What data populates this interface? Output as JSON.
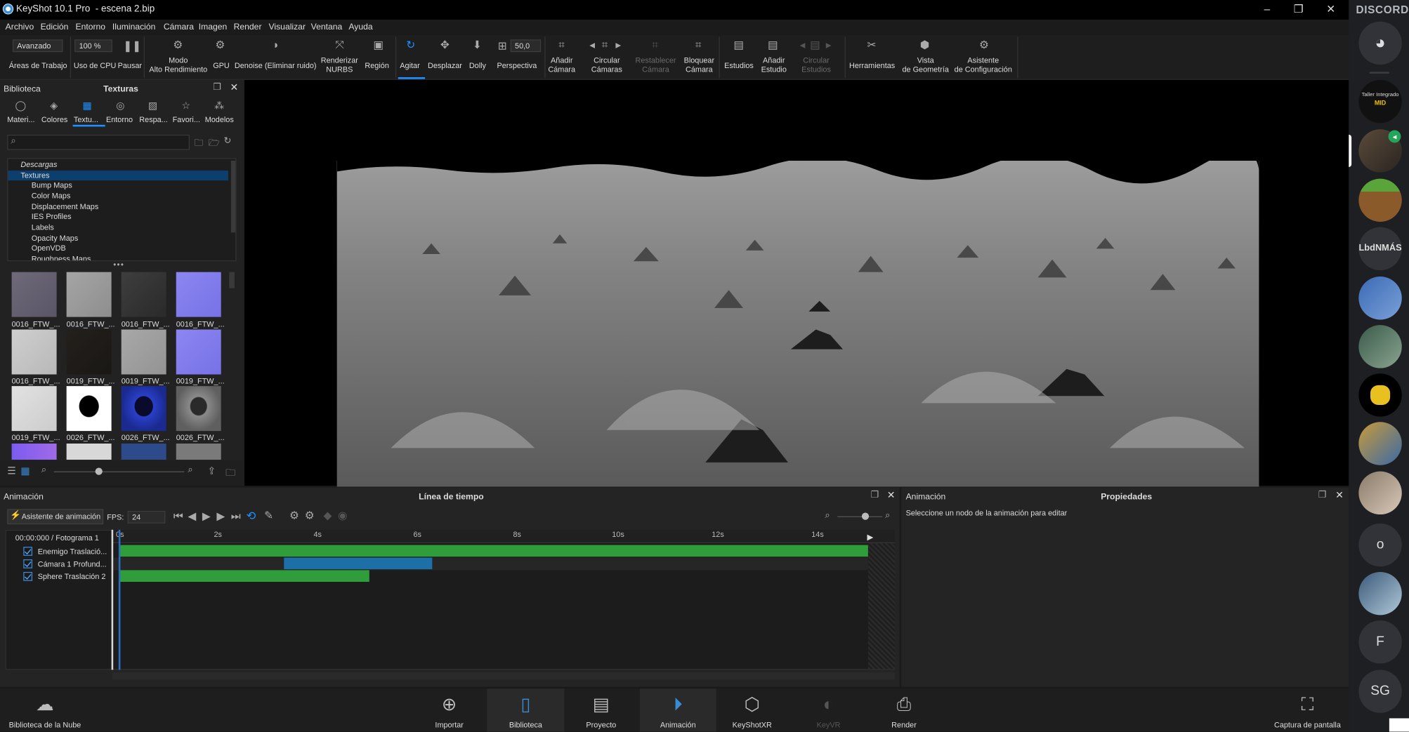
{
  "window": {
    "title": "KeyShot 10.1 Pro  - escena 2.bip"
  },
  "menu": [
    "Archivo",
    "Edición",
    "Entorno",
    "Iluminación",
    "Cámara",
    "Imagen",
    "Render",
    "Visualizar",
    "Ventana",
    "Ayuda"
  ],
  "toolbar": {
    "workspace_dropdown": "Avanzado",
    "cpu_dropdown": "100 %",
    "perspective_value": "50,0",
    "areas": "Áreas de Trabajo",
    "cpu": "Uso de CPU",
    "pause": "Pausar",
    "high_perf_1": "Modo",
    "high_perf_2": "Alto Rendimiento",
    "gpu": "GPU",
    "denoise": "Denoise (Eliminar ruido)",
    "nurbs_1": "Renderizar",
    "nurbs_2": "NURBS",
    "region": "Región",
    "shake": "Agitar",
    "pan": "Desplazar",
    "dolly": "Dolly",
    "perspective": "Perspectiva",
    "add_cam_1": "Añadir",
    "add_cam_2": "Cámara",
    "cycle_cam_1": "Circular",
    "cycle_cam_2": "Cámaras",
    "reset_cam_1": "Restablecer",
    "reset_cam_2": "Cámara",
    "lock_cam_1": "Bloquear",
    "lock_cam_2": "Cámara",
    "studios": "Estudios",
    "add_studio_1": "Añadir",
    "add_studio_2": "Estudio",
    "cycle_studio_1": "Circular",
    "cycle_studio_2": "Estudios",
    "tools": "Herramientas",
    "geom_view_1": "Vista",
    "geom_view_2": "de Geometría",
    "config_wizard_1": "Asistente",
    "config_wizard_2": "de Configuración"
  },
  "library": {
    "panel_title": "Biblioteca",
    "title": "Texturas",
    "tabs": [
      "Materi...",
      "Colores",
      "Textu...",
      "Entorno",
      "Respa...",
      "Favori...",
      "Modelos"
    ],
    "tree": [
      "Descargas",
      "Textures",
      "Bump Maps",
      "Color Maps",
      "Displacement Maps",
      "IES Profiles",
      "Labels",
      "Opacity Maps",
      "OpenVDB",
      "Roughness Maps"
    ],
    "thumbs": [
      "0016_FTW_...",
      "0016_FTW_...",
      "0016_FTW_...",
      "0016_FTW_...",
      "0016_FTW_...",
      "0019_FTW_...",
      "0019_FTW_...",
      "0019_FTW_...",
      "0019_FTW_...",
      "0026_FTW_...",
      "0026_FTW_...",
      "0026_FTW_..."
    ]
  },
  "animation": {
    "panel_title": "Animación",
    "timeline_title": "Línea de tiempo",
    "wizard": "Asistente de animación",
    "fps_label": "FPS:",
    "fps": "24",
    "time": "00:00:000 / Fotograma 1",
    "ticks": [
      "0s",
      "2s",
      "4s",
      "6s",
      "8s",
      "10s",
      "12s",
      "14s"
    ],
    "tracks": [
      "Enemigo Traslació...",
      "Cámara 1 Profund...",
      "Sphere Traslación 2"
    ]
  },
  "properties": {
    "panel_title": "Animación",
    "title": "Propiedades",
    "hint": "Seleccione un nodo de la animación para editar"
  },
  "bottom": [
    "Biblioteca de la Nube",
    "Importar",
    "Biblioteca",
    "Proyecto",
    "Animación",
    "KeyShotXR",
    "KeyVR",
    "Render",
    "Captura de pantalla"
  ],
  "discord": {
    "brand": "DISCORD",
    "server_label": "Taller Integrado",
    "server_sub": "MID",
    "servers_text": [
      "LbdNMÁS",
      "o",
      "F",
      "SG"
    ]
  },
  "colors": {
    "accent": "#1e90ff",
    "green_bar": "#2f9e3a",
    "blue_bar": "#1d6fa8"
  }
}
